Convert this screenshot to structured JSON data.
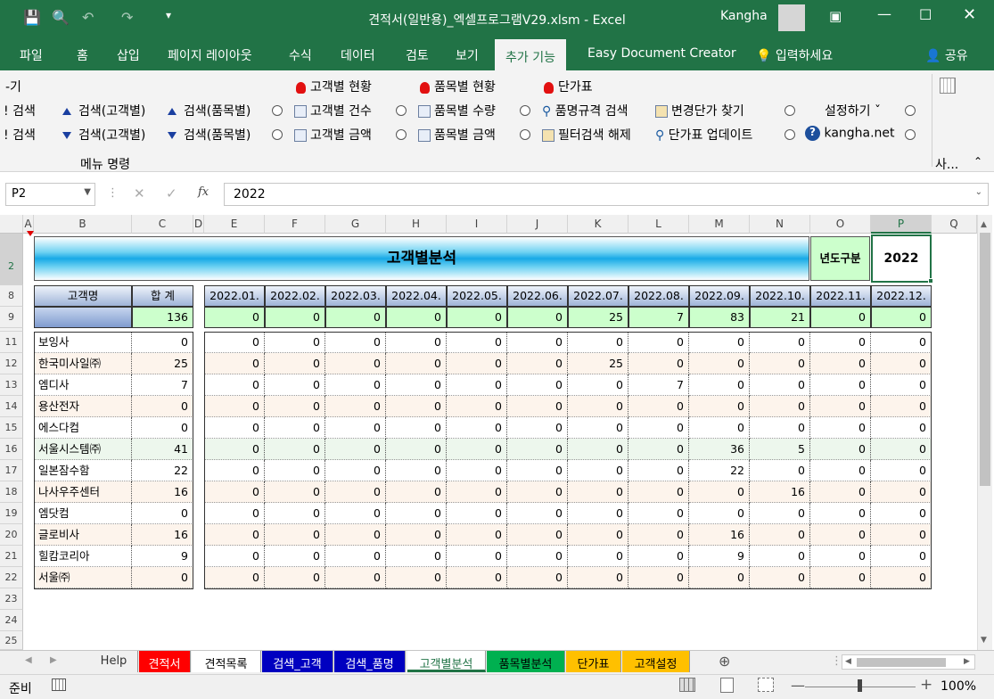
{
  "window": {
    "title": "견적서(일반용)_엑셀프로그램V29.xlsm  -  Excel",
    "user": "Kangha"
  },
  "tabs": [
    "파일",
    "홈",
    "삽입",
    "페이지 레이아웃",
    "수식",
    "데이터",
    "검토",
    "보기",
    "추가 기능",
    "Easy Document Creator",
    "입력하세요",
    "공유"
  ],
  "ribbon": {
    "partial_top": "-기",
    "search_left1": "! 검색",
    "search_left2": "! 검색",
    "search_cust_up": "검색(고객별)",
    "search_cust_dn": "검색(고객별)",
    "search_item_up": "검색(품목별)",
    "search_item_dn": "검색(품목별)",
    "cust_status": "고객별 현황",
    "item_status": "품목별 현황",
    "price_table": "단가표",
    "cust_count": "고객별 건수",
    "cust_amount": "고객별 금액",
    "item_qty": "품목별 수량",
    "item_amount": "품목별 금액",
    "spec_search": "품명규격 검색",
    "filter_clear": "필터검색 해제",
    "price_find": "변경단가 찾기",
    "price_update": "단가표 업데이트",
    "settings": "설정하기",
    "site": "kangha.net",
    "group_label": "메뉴 명령",
    "group_right": "사..."
  },
  "formula_bar": {
    "name_box": "P2",
    "value": "2022"
  },
  "columns": [
    "A",
    "B",
    "C",
    "D",
    "E",
    "F",
    "G",
    "H",
    "I",
    "J",
    "K",
    "L",
    "M",
    "N",
    "O",
    "P",
    "Q"
  ],
  "rows": [
    "2",
    "8",
    "9",
    "11",
    "12",
    "13",
    "14",
    "15",
    "16",
    "17",
    "18",
    "19",
    "20",
    "21",
    "22",
    "23",
    "24",
    "25"
  ],
  "sheet": {
    "title": "고객별분석",
    "year_label": "년도구분",
    "year": "2022",
    "hdr_customer": "고객명",
    "hdr_total": "합 계",
    "months": [
      "2022.01.",
      "2022.02.",
      "2022.03.",
      "2022.04.",
      "2022.05.",
      "2022.06.",
      "2022.07.",
      "2022.08.",
      "2022.09.",
      "2022.10.",
      "2022.11.",
      "2022.12."
    ],
    "total_sum": "136",
    "month_totals": [
      "0",
      "0",
      "0",
      "0",
      "0",
      "0",
      "25",
      "7",
      "83",
      "21",
      "0",
      "0"
    ],
    "customers": [
      {
        "name": "보잉사",
        "total": "0",
        "m": [
          "0",
          "0",
          "0",
          "0",
          "0",
          "0",
          "0",
          "0",
          "0",
          "0",
          "0",
          "0"
        ]
      },
      {
        "name": "한국미사일㈜",
        "total": "25",
        "m": [
          "0",
          "0",
          "0",
          "0",
          "0",
          "0",
          "25",
          "0",
          "0",
          "0",
          "0",
          "0"
        ]
      },
      {
        "name": "엠디사",
        "total": "7",
        "m": [
          "0",
          "0",
          "0",
          "0",
          "0",
          "0",
          "0",
          "7",
          "0",
          "0",
          "0",
          "0"
        ]
      },
      {
        "name": "용산전자",
        "total": "0",
        "m": [
          "0",
          "0",
          "0",
          "0",
          "0",
          "0",
          "0",
          "0",
          "0",
          "0",
          "0",
          "0"
        ]
      },
      {
        "name": "에스다컴",
        "total": "0",
        "m": [
          "0",
          "0",
          "0",
          "0",
          "0",
          "0",
          "0",
          "0",
          "0",
          "0",
          "0",
          "0"
        ]
      },
      {
        "name": "서울시스템㈜",
        "total": "41",
        "m": [
          "0",
          "0",
          "0",
          "0",
          "0",
          "0",
          "0",
          "0",
          "36",
          "5",
          "0",
          "0"
        ]
      },
      {
        "name": "일본잠수함",
        "total": "22",
        "m": [
          "0",
          "0",
          "0",
          "0",
          "0",
          "0",
          "0",
          "0",
          "22",
          "0",
          "0",
          "0"
        ]
      },
      {
        "name": "나사우주센터",
        "total": "16",
        "m": [
          "0",
          "0",
          "0",
          "0",
          "0",
          "0",
          "0",
          "0",
          "0",
          "16",
          "0",
          "0"
        ]
      },
      {
        "name": "엠닷컴",
        "total": "0",
        "m": [
          "0",
          "0",
          "0",
          "0",
          "0",
          "0",
          "0",
          "0",
          "0",
          "0",
          "0",
          "0"
        ]
      },
      {
        "name": "글로비사",
        "total": "16",
        "m": [
          "0",
          "0",
          "0",
          "0",
          "0",
          "0",
          "0",
          "0",
          "16",
          "0",
          "0",
          "0"
        ]
      },
      {
        "name": "힐캄코리아",
        "total": "9",
        "m": [
          "0",
          "0",
          "0",
          "0",
          "0",
          "0",
          "0",
          "0",
          "9",
          "0",
          "0",
          "0"
        ]
      },
      {
        "name": "서울㈜",
        "total": "0",
        "m": [
          "0",
          "0",
          "0",
          "0",
          "0",
          "0",
          "0",
          "0",
          "0",
          "0",
          "0",
          "0"
        ]
      }
    ]
  },
  "sheet_tabs": [
    {
      "label": "Help",
      "bg": "#f0f0f0",
      "fg": "#333"
    },
    {
      "label": "견적서",
      "bg": "#ff0000",
      "fg": "#ffffff"
    },
    {
      "label": "견적목록",
      "bg": "#ffffff",
      "fg": "#000000"
    },
    {
      "label": "검색_고객",
      "bg": "#0000c0",
      "fg": "#ffffff"
    },
    {
      "label": "검색_품명",
      "bg": "#0000c0",
      "fg": "#ffffff"
    },
    {
      "label": "고객별분석",
      "bg": "#ffffff",
      "fg": "#217346"
    },
    {
      "label": "품목별분석",
      "bg": "#00b050",
      "fg": "#000000"
    },
    {
      "label": "단가표",
      "bg": "#ffc000",
      "fg": "#000000"
    },
    {
      "label": "고객설정",
      "bg": "#ffc000",
      "fg": "#000000"
    }
  ],
  "status": {
    "ready": "준비",
    "zoom": "100%"
  }
}
